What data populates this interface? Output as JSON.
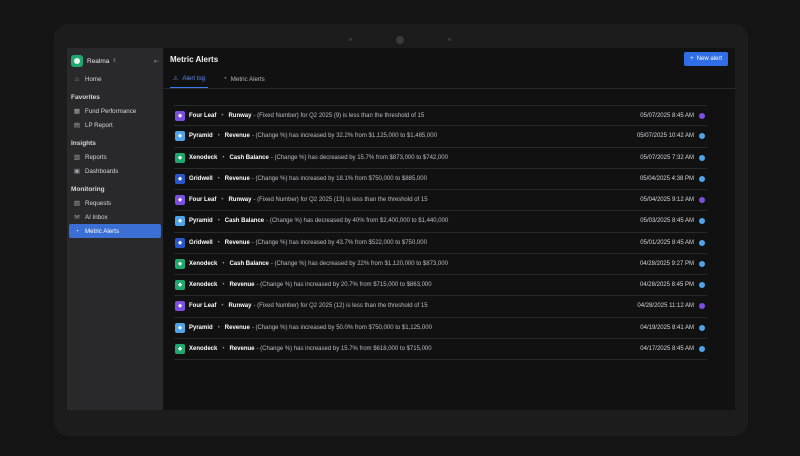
{
  "workspace": {
    "name": "Realma"
  },
  "sidebar": {
    "home": "Home",
    "sections": [
      {
        "title": "Favorites",
        "items": [
          {
            "label": "Fund Performance",
            "icon": "grid-icon"
          },
          {
            "label": "LP Report",
            "icon": "doc-icon"
          }
        ]
      },
      {
        "title": "Insights",
        "items": [
          {
            "label": "Reports",
            "icon": "report-icon"
          },
          {
            "label": "Dashboards",
            "icon": "dashboard-icon"
          }
        ]
      },
      {
        "title": "Monitoring",
        "items": [
          {
            "label": "Requests",
            "icon": "requests-icon"
          },
          {
            "label": "AI Inbox",
            "icon": "inbox-icon"
          },
          {
            "label": "Metric Alerts",
            "icon": "alert-icon",
            "active": true
          }
        ]
      }
    ]
  },
  "header": {
    "title": "Metric Alerts",
    "new_button": "New alert"
  },
  "tabs": [
    {
      "label": "Alert log",
      "active": true
    },
    {
      "label": "Metric Alerts",
      "active": false
    }
  ],
  "colors": {
    "accent": "#2f6ee6",
    "four_leaf": "#7b4fe0",
    "pyramid": "#4fa3e8",
    "xenodeck": "#1fa971",
    "gridwell": "#2a57c8"
  },
  "alerts": [
    {
      "company": "Four Leaf",
      "metric": "Runway",
      "message": "- (Fixed Number) for Q2 2025 (9) is less than the threshold of 15",
      "date": "05/07/2025 8:45 AM",
      "logo_color": "#7b4fe0",
      "status_color": "#7b4fe0"
    },
    {
      "company": "Pyramid",
      "metric": "Revenue",
      "message": "- (Change %) has increased by 32.2% from $1,125,000 to $1,485,000",
      "date": "05/07/2025 10:42 AM",
      "logo_color": "#4fa3e8",
      "status_color": "#4fa3e8"
    },
    {
      "company": "Xenodeck",
      "metric": "Cash Balance",
      "message": "- (Change %) has decreased by 15.7% from $873,000 to $742,000",
      "date": "05/07/2025 7:32 AM",
      "logo_color": "#1fa971",
      "status_color": "#4fa3e8"
    },
    {
      "company": "Gridwell",
      "metric": "Revenue",
      "message": "- (Change %) has increased by 18.1% from $750,000 to $885,000",
      "date": "05/04/2025 4:38 PM",
      "logo_color": "#2a57c8",
      "status_color": "#4fa3e8"
    },
    {
      "company": "Four Leaf",
      "metric": "Runway",
      "message": "- (Fixed Number) for Q2 2025 (13) is less than the threshold of 15",
      "date": "05/04/2025 9:12 AM",
      "logo_color": "#7b4fe0",
      "status_color": "#7b4fe0"
    },
    {
      "company": "Pyramid",
      "metric": "Cash Balance",
      "message": "- (Change %) has decreased by 40% from $2,400,000 to $1,440,000",
      "date": "05/03/2025 8:45 AM",
      "logo_color": "#4fa3e8",
      "status_color": "#4fa3e8"
    },
    {
      "company": "Gridwell",
      "metric": "Revenue",
      "message": "- (Change %) has increased by 43.7% from $522,000 to $750,000",
      "date": "05/01/2025 8:45 AM",
      "logo_color": "#2a57c8",
      "status_color": "#4fa3e8"
    },
    {
      "company": "Xenodeck",
      "metric": "Cash Balance",
      "message": "- (Change %) has decreased by 22% from $1,120,000 to $873,000",
      "date": "04/28/2025 9:27 PM",
      "logo_color": "#1fa971",
      "status_color": "#4fa3e8"
    },
    {
      "company": "Xenodeck",
      "metric": "Revenue",
      "message": "- (Change %) has increased by 20.7% from $715,000 to $863,000",
      "date": "04/28/2025 8:45 PM",
      "logo_color": "#1fa971",
      "status_color": "#4fa3e8"
    },
    {
      "company": "Four Leaf",
      "metric": "Runway",
      "message": "- (Fixed Number) for Q2 2025 (12) is less than the threshold of 15",
      "date": "04/28/2025 11:12 AM",
      "logo_color": "#7b4fe0",
      "status_color": "#7b4fe0"
    },
    {
      "company": "Pyramid",
      "metric": "Revenue",
      "message": "- (Change %) has increased by 50.0% from $750,000 to $1,125,000",
      "date": "04/19/2025 8:41 AM",
      "logo_color": "#4fa3e8",
      "status_color": "#4fa3e8"
    },
    {
      "company": "Xenodeck",
      "metric": "Revenue",
      "message": "- (Change %) has increased by 15.7% from $618,000 to $715,000",
      "date": "04/17/2025 8:45 AM",
      "logo_color": "#1fa971",
      "status_color": "#4fa3e8"
    }
  ]
}
